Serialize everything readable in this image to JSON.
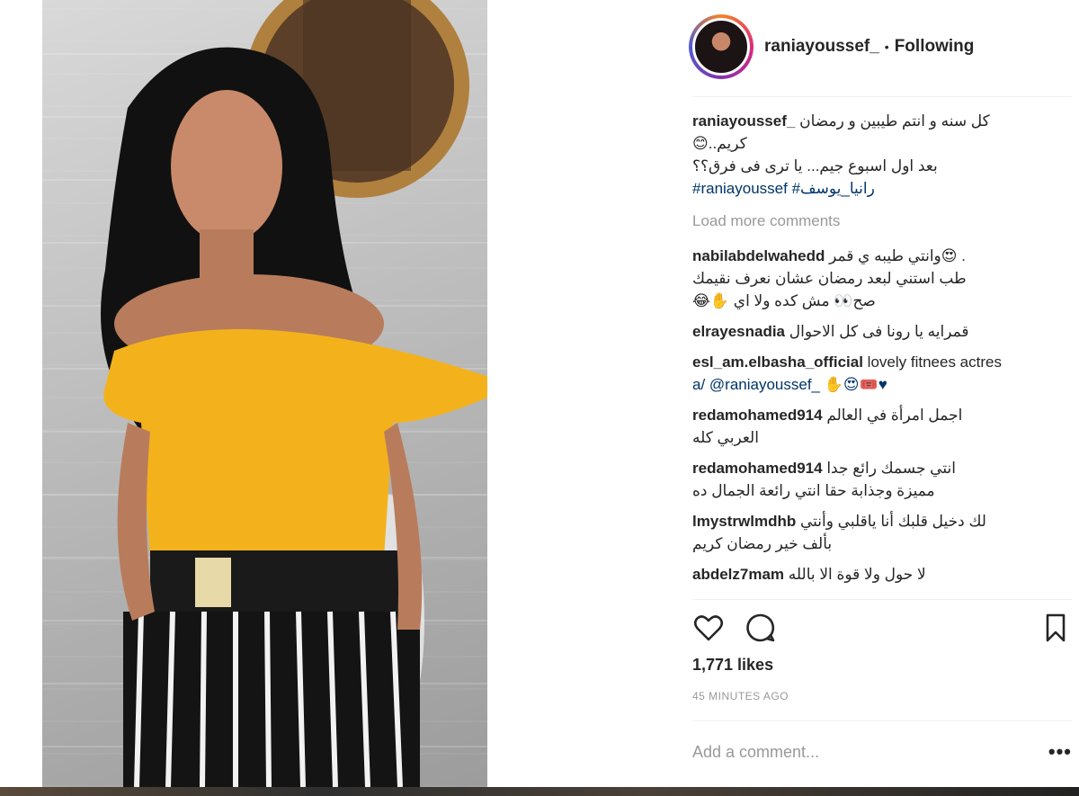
{
  "post": {
    "username": "raniayoussef_",
    "separator": "•",
    "follow_status": "Following",
    "caption": {
      "username": "raniayoussef_",
      "lines": [
        "كل سنه و انتم طيبين و رمضان",
        "كريم..😊",
        "بعد اول اسبوع جيم... يا ترى فى فرق؟؟"
      ],
      "hashtags": "#raniayoussef #رانيا_يوسف"
    },
    "load_more": "Load more comments",
    "comments": [
      {
        "username": "nabilabdelwahedd",
        "lines": [
          "وانتي طيبه ي قمر😍 .",
          "طب استني لبعد رمضان عشان نعرف نقيمك",
          "😂✋ صح👀 مش كده ولا اي"
        ]
      },
      {
        "username": "elrayesnadia",
        "lines": [
          "قمرايه يا رونا فى كل الاحوال"
        ]
      },
      {
        "username": "esl_am.elbasha_official",
        "lines": [
          "lovely fitnees actres",
          "a/ @raniayoussef_ ✋😍🎟️♥"
        ]
      },
      {
        "username": "redamohamed914",
        "lines": [
          "اجمل امرأة في العالم",
          "العربي كله"
        ]
      },
      {
        "username": "redamohamed914",
        "lines": [
          "انتي جسمك رائع جدا",
          "مميزة وجذابة حقا انتي رائعة الجمال ده"
        ]
      },
      {
        "username": "lmystrwlmdhb",
        "lines": [
          "لك دخيل قلبك أنا ياقلبي وأنتي",
          "بألف خير رمضان كريم"
        ]
      },
      {
        "username": "abdelz7mam",
        "lines": [
          "لا حول ولا قوة الا بالله"
        ]
      }
    ],
    "likes": "1,771 likes",
    "timestamp": "45 MINUTES AGO",
    "add_comment_placeholder": "Add a comment...",
    "more_options": "•••"
  },
  "icons": {
    "like": "heart-icon",
    "comment": "speech-bubble-icon",
    "save": "bookmark-icon"
  },
  "colors": {
    "text": "#262626",
    "muted": "#999999",
    "link": "#003569",
    "divider": "#efefef",
    "top_yellow": "#f3b21c"
  }
}
